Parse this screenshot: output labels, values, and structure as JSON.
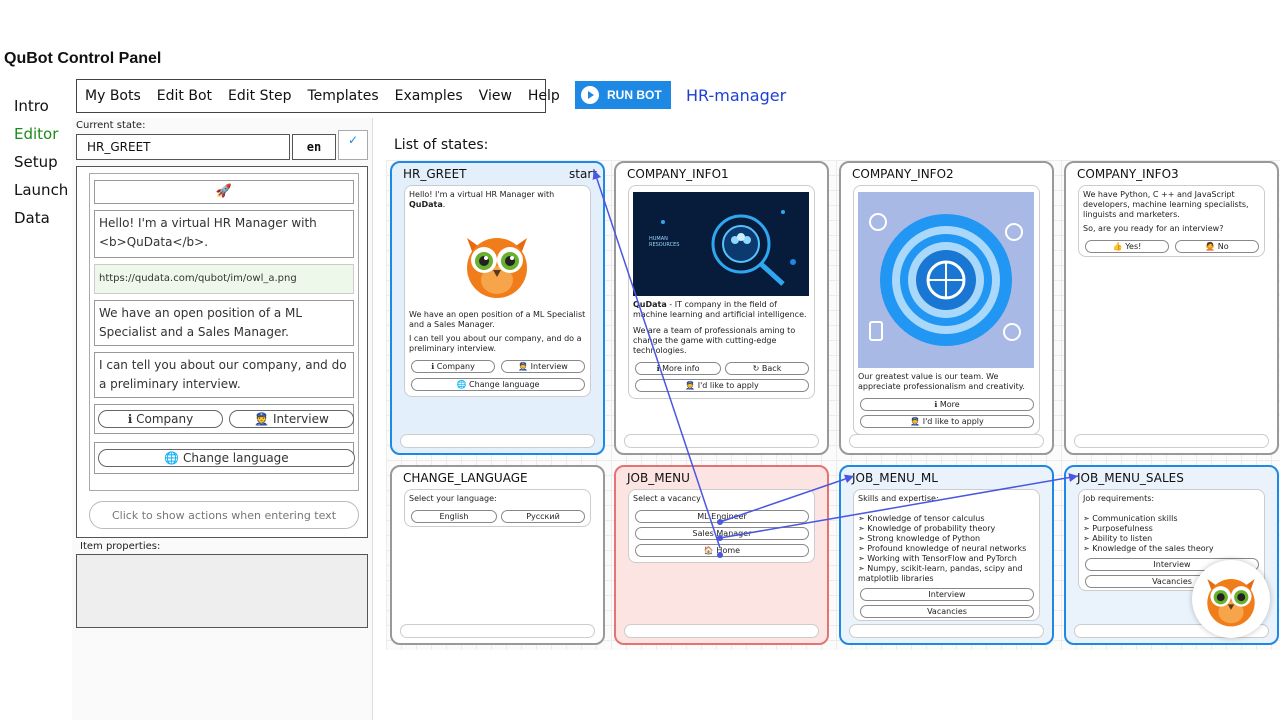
{
  "app": {
    "title": "QuBot Control Panel"
  },
  "nav": [
    {
      "label": "Intro"
    },
    {
      "label": "Editor"
    },
    {
      "label": "Setup"
    },
    {
      "label": "Launch"
    },
    {
      "label": "Data"
    }
  ],
  "menu": [
    {
      "label": "My Bots"
    },
    {
      "label": "Edit Bot"
    },
    {
      "label": "Edit Step"
    },
    {
      "label": "Templates"
    },
    {
      "label": "Examples"
    },
    {
      "label": "View"
    },
    {
      "label": "Help"
    }
  ],
  "run_button": {
    "label": "RUN BOT"
  },
  "bot_name": "HR-manager",
  "editor": {
    "current_state_label": "Current state:",
    "current_state": "HR_GREET",
    "lang": "en",
    "check": "✓",
    "rocket": "🚀",
    "text1": "Hello! I'm a virtual HR Manager with <b>QuData</b>.",
    "image_url": "https://qudata.com/qubot/im/owl_a.png",
    "text2": "We have an open position of a ML Specialist and a Sales Manager.",
    "text3": "I can tell you about our company, and do a preliminary interview.",
    "btn_company": "ℹ Company",
    "btn_interview": "👮 Interview",
    "btn_change_lang": "🌐 Change language",
    "click_hint": "Click to show actions when entering text",
    "item_properties_label": "Item properties:"
  },
  "states_title": "List of states:",
  "cards": {
    "hr_greet": {
      "title": "HR_GREET",
      "start": "start",
      "msg1": "Hello! I'm a virtual HR Manager with",
      "msg1_bold": "QuData",
      "msg1_end": ".",
      "msg2": "We have an open position of a ML Specialist and a Sales Manager.",
      "msg3": "I can tell you about our company, and do a preliminary interview.",
      "b1": "ℹ Company",
      "b2": "👮 Interview",
      "b3": "🌐 Change language"
    },
    "company_info1": {
      "title": "COMPANY_INFO1",
      "img_text": "HUMAN RESOURCES",
      "msg_bold": "QuData",
      "msg": " - IT company in the field of machine learning and artificial intelligence.",
      "msg2": "We are a team of professionals aming to change the game with cutting-edge technologies.",
      "b1": "ℹ More info",
      "b2": "↻ Back",
      "b3": "👮 I'd like to apply"
    },
    "company_info2": {
      "title": "COMPANY_INFO2",
      "msg": "Our greatest value is our team. We appreciate professionalism and creativity.",
      "b1": "ℹ More",
      "b2": "👮 I'd like to apply"
    },
    "company_info3": {
      "title": "COMPANY_INFO3",
      "msg": "We have Python, C ++ and JavaScript developers, machine learning specialists, linguists and marketers.",
      "msg2": "So, are you ready for an interview?",
      "b1": "👍 Yes!",
      "b2": "🙅 No"
    },
    "change_language": {
      "title": "CHANGE_LANGUAGE",
      "msg": "Select your language:",
      "b1": "English",
      "b2": "Русский"
    },
    "job_menu": {
      "title": "JOB_MENU",
      "msg": "Select a vacancy",
      "b1": "ML Engineer",
      "b2": "Sales Manager",
      "b3": "🏠 Home"
    },
    "job_menu_ml": {
      "title": "JOB_MENU_ML",
      "msg": "Skills and expertise:",
      "items": [
        "➣ Knowledge of tensor calculus",
        "➣ Knowledge of probability theory",
        "➣ Strong knowledge of Python",
        "➣ Profound knowledge of neural networks",
        "➣ Working with TensorFlow and PyTorch",
        "➣ Numpy, scikit-learn, pandas, scipy and matplotlib libraries"
      ],
      "b1": "Interview",
      "b2": "Vacancies"
    },
    "job_menu_sales": {
      "title": "JOB_MENU_SALES",
      "msg": "Job requirements:",
      "items": [
        "➣ Communication skills",
        "➣ Purposefulness",
        "➣ Ability to listen",
        "➣ Knowledge of the sales theory"
      ],
      "b1": "Interview",
      "b2": "Vacancies"
    }
  },
  "colors": {
    "accent": "#1e88e5",
    "active_nav": "#1b8a1b",
    "bot_name": "#1c3fd8",
    "arrow": "#4a57e0",
    "owl_body": "#f07d1a"
  }
}
